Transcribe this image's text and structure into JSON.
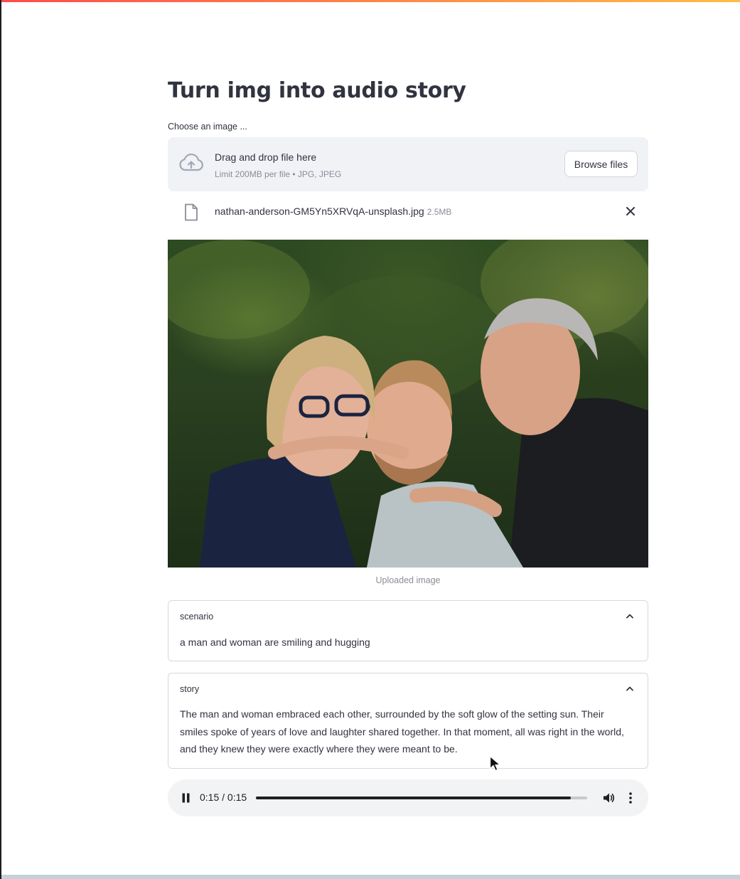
{
  "page": {
    "title": "Turn img into audio story"
  },
  "uploader": {
    "label": "Choose an image ...",
    "dropzone_title": "Drag and drop file here",
    "dropzone_limit": "Limit 200MB per file • JPG, JPEG",
    "browse_label": "Browse files",
    "upload_icon": "cloud-upload-icon"
  },
  "file": {
    "name": "nathan-anderson-GM5Yn5XRVqA-unsplash.jpg",
    "size": "2.5MB",
    "icon": "file-icon",
    "remove_icon": "close-icon"
  },
  "image": {
    "caption": "Uploaded image"
  },
  "expanders": {
    "scenario": {
      "label": "scenario",
      "text": "a man and woman are smiling and hugging",
      "expanded": true
    },
    "story": {
      "label": "story",
      "text": "The man and woman embraced each other, surrounded by the soft glow of the setting sun. Their smiles spoke of years of love and laughter shared together. In that moment, all was right in the world, and they knew they were exactly where they were meant to be.",
      "expanded": true
    }
  },
  "audio": {
    "time": "0:15 / 0:15",
    "progress": 0.95,
    "state": "playing",
    "pause_icon": "pause-icon",
    "volume_icon": "volume-icon",
    "more_icon": "more-vertical-icon"
  },
  "colors": {
    "text": "#31333f",
    "muted": "#8a8d96",
    "dropzone_bg": "#f0f2f6",
    "border": "#d6d8de",
    "audio_bg": "#f1f3f4"
  }
}
